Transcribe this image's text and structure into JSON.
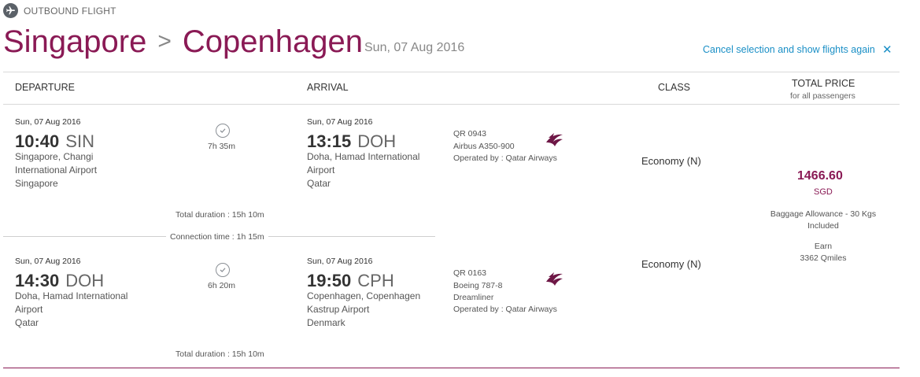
{
  "header": {
    "outbound_label": "OUTBOUND FLIGHT",
    "origin": "Singapore",
    "separator": ">",
    "destination": "Copenhagen",
    "date": "Sun, 07 Aug 2016",
    "cancel_label": "Cancel selection and show flights again",
    "close_glyph": "✕"
  },
  "columns": {
    "departure": "DEPARTURE",
    "arrival": "ARRIVAL",
    "class": "CLASS",
    "total_price": "TOTAL PRICE",
    "total_price_sub": "for all passengers"
  },
  "segments": [
    {
      "dep_date": "Sun, 07 Aug 2016",
      "dep_time": "10:40",
      "dep_code": "SIN",
      "dep_place": "Singapore, Changi International Airport",
      "dep_country": "Singapore",
      "duration": "7h 35m",
      "arr_date": "Sun, 07 Aug 2016",
      "arr_time": "13:15",
      "arr_code": "DOH",
      "arr_place": "Doha, Hamad International Airport",
      "arr_country": "Qatar",
      "flight_no": "QR 0943",
      "aircraft": "Airbus A350-900",
      "operated_by": "Operated by : Qatar Airways",
      "class": "Economy (N)",
      "total_duration": "Total duration : 15h 10m"
    },
    {
      "dep_date": "Sun, 07 Aug 2016",
      "dep_time": "14:30",
      "dep_code": "DOH",
      "dep_place": "Doha, Hamad International Airport",
      "dep_country": "Qatar",
      "duration": "6h 20m",
      "arr_date": "Sun, 07 Aug 2016",
      "arr_time": "19:50",
      "arr_code": "CPH",
      "arr_place": "Copenhagen, Copenhagen Kastrup Airport",
      "arr_country": "Denmark",
      "flight_no": "QR 0163",
      "aircraft": "Boeing 787-8 Dreamliner",
      "operated_by": "Operated by : Qatar Airways",
      "class": "Economy (N)",
      "total_duration": "Total duration : 15h 10m"
    }
  ],
  "connection": "Connection time : 1h 15m",
  "price": {
    "amount": "1466.60",
    "currency": "SGD",
    "baggage": "Baggage Allowance - 30 Kgs Included",
    "earn_label": "Earn",
    "earn_value": "3362 Qmiles"
  },
  "colors": {
    "brand": "#8a1a55",
    "link": "#1a8fc6"
  },
  "icons": {
    "plane": "plane-icon",
    "clock": "clock-icon",
    "airline": "airline-logo-icon",
    "close": "close-icon"
  }
}
